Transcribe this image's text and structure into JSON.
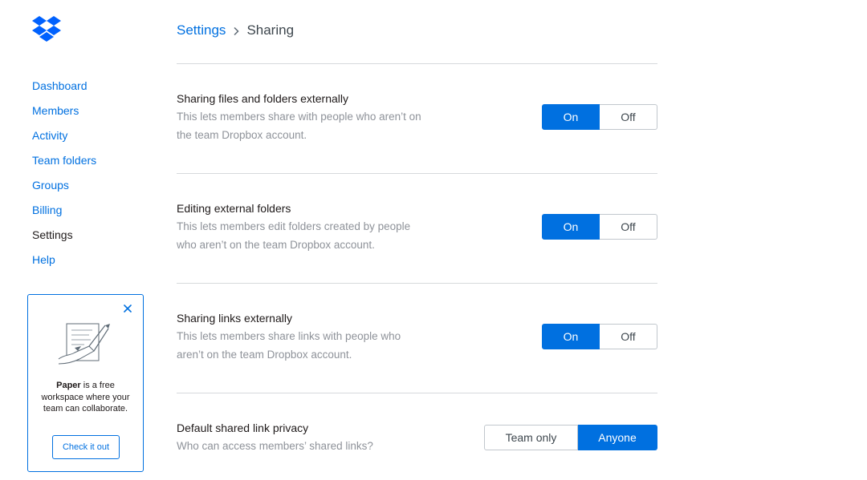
{
  "brand": {
    "accent": "#0070e0",
    "logo_icon": "dropbox-logo-icon"
  },
  "sidebar": {
    "items": [
      {
        "label": "Dashboard",
        "active": false
      },
      {
        "label": "Members",
        "active": false
      },
      {
        "label": "Activity",
        "active": false
      },
      {
        "label": "Team folders",
        "active": false
      },
      {
        "label": "Groups",
        "active": false
      },
      {
        "label": "Billing",
        "active": false
      },
      {
        "label": "Settings",
        "active": true
      },
      {
        "label": "Help",
        "active": false
      }
    ]
  },
  "promo": {
    "close_icon": "close-icon",
    "illustration_icon": "paper-illustration-icon",
    "bold_text": "Paper",
    "text": " is a free workspace where your team can collaborate.",
    "button_label": "Check it out"
  },
  "breadcrumb": {
    "parent": "Settings",
    "separator_icon": "chevron-right-icon",
    "current": "Sharing"
  },
  "settings": [
    {
      "title": "Sharing files and folders externally",
      "description": "This lets members share with people who aren’t on the team Dropbox account.",
      "options": [
        "On",
        "Off"
      ],
      "selected": "On"
    },
    {
      "title": "Editing external folders",
      "description": "This lets members edit folders created by people who aren’t on the team Dropbox account.",
      "options": [
        "On",
        "Off"
      ],
      "selected": "On"
    },
    {
      "title": "Sharing links externally",
      "description": "This lets members share links with people who aren’t on the team Dropbox account.",
      "options": [
        "On",
        "Off"
      ],
      "selected": "On"
    },
    {
      "title": "Default shared link privacy",
      "description": "Who can access members’ shared links?",
      "options": [
        "Team only",
        "Anyone"
      ],
      "selected": "Anyone"
    }
  ]
}
